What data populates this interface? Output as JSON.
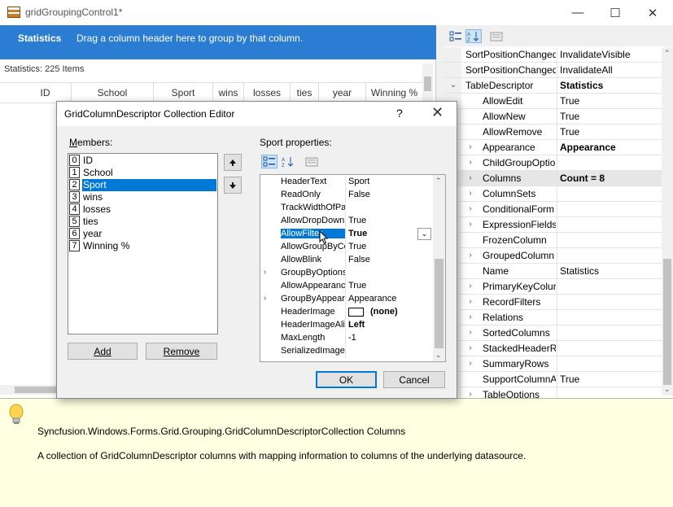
{
  "window": {
    "title": "gridGroupingControl1*",
    "minimize": "—",
    "maximize": "☐",
    "close": "✕"
  },
  "grid": {
    "table_title": "Statistics",
    "group_hint": "Drag a column header here to group by that column.",
    "stats_count": "Statistics: 225 Items",
    "columns": [
      "ID",
      "School",
      "Sport",
      "wins",
      "losses",
      "ties",
      "year",
      "Winning %"
    ]
  },
  "property_grid": {
    "rows": [
      {
        "name": "SortPositionChanged",
        "value": "InvalidateVisible",
        "indent": 1,
        "expander": "",
        "bold": false
      },
      {
        "name": "SortPositionChanged",
        "value": "InvalidateAll",
        "indent": 1,
        "expander": "",
        "bold": false
      },
      {
        "name": "TableDescriptor",
        "value": "Statistics",
        "indent": 1,
        "expander": "⌄",
        "bold": true
      },
      {
        "name": "AllowEdit",
        "value": "True",
        "indent": 2,
        "expander": "",
        "bold": false
      },
      {
        "name": "AllowNew",
        "value": "True",
        "indent": 2,
        "expander": "",
        "bold": false
      },
      {
        "name": "AllowRemove",
        "value": "True",
        "indent": 2,
        "expander": "",
        "bold": false
      },
      {
        "name": "Appearance",
        "value": "Appearance",
        "indent": 2,
        "expander": "›",
        "bold": true
      },
      {
        "name": "ChildGroupOptio",
        "value": "",
        "indent": 2,
        "expander": "›",
        "bold": false
      },
      {
        "name": "Columns",
        "value": "Count = 8",
        "indent": 2,
        "expander": "›",
        "bold": true,
        "selected": true
      },
      {
        "name": "ColumnSets",
        "value": "",
        "indent": 2,
        "expander": "›",
        "bold": false
      },
      {
        "name": "ConditionalForm",
        "value": "",
        "indent": 2,
        "expander": "›",
        "bold": false
      },
      {
        "name": "ExpressionFields",
        "value": "",
        "indent": 2,
        "expander": "›",
        "bold": false
      },
      {
        "name": "FrozenColumn",
        "value": "",
        "indent": 2,
        "expander": "",
        "bold": false
      },
      {
        "name": "GroupedColumn",
        "value": "",
        "indent": 2,
        "expander": "›",
        "bold": false
      },
      {
        "name": "Name",
        "value": "Statistics",
        "indent": 2,
        "expander": "",
        "bold": false
      },
      {
        "name": "PrimaryKeyColur",
        "value": "",
        "indent": 2,
        "expander": "›",
        "bold": false
      },
      {
        "name": "RecordFilters",
        "value": "",
        "indent": 2,
        "expander": "›",
        "bold": false
      },
      {
        "name": "Relations",
        "value": "",
        "indent": 2,
        "expander": "›",
        "bold": false
      },
      {
        "name": "SortedColumns",
        "value": "",
        "indent": 2,
        "expander": "›",
        "bold": false
      },
      {
        "name": "StackedHeaderRc",
        "value": "",
        "indent": 2,
        "expander": "›",
        "bold": false
      },
      {
        "name": "SummaryRows",
        "value": "",
        "indent": 2,
        "expander": "›",
        "bold": false
      },
      {
        "name": "SupportColumnA",
        "value": "True",
        "indent": 2,
        "expander": "",
        "bold": false
      },
      {
        "name": "TableOptions",
        "value": "",
        "indent": 2,
        "expander": "›",
        "bold": false
      }
    ]
  },
  "description": {
    "title": "Syncfusion.Windows.Forms.Grid.Grouping.GridColumnDescriptorCollection Columns",
    "text": "A collection of GridColumnDescriptor columns with mapping information to columns of the underlying datasource."
  },
  "dialog": {
    "title": "GridColumnDescriptor Collection Editor",
    "help": "?",
    "close": "✕",
    "members_label": "Members:",
    "members": [
      {
        "index": "0",
        "name": "ID"
      },
      {
        "index": "1",
        "name": "School"
      },
      {
        "index": "2",
        "name": "Sport",
        "selected": true
      },
      {
        "index": "3",
        "name": "wins"
      },
      {
        "index": "4",
        "name": "losses"
      },
      {
        "index": "5",
        "name": "ties"
      },
      {
        "index": "6",
        "name": "year"
      },
      {
        "index": "7",
        "name": "Winning %"
      }
    ],
    "add_label": "Add",
    "remove_label": "Remove",
    "properties_label": "Sport properties:",
    "properties": [
      {
        "name": "HeaderText",
        "value": "Sport",
        "expander": "",
        "bold": false
      },
      {
        "name": "ReadOnly",
        "value": "False",
        "expander": "",
        "bold": false
      },
      {
        "name": "TrackWidthOfPa",
        "value": "",
        "expander": "",
        "bold": false
      },
      {
        "name": "AllowDropDown(",
        "value": "True",
        "expander": "",
        "bold": false
      },
      {
        "name": "AllowFilter",
        "value": "True",
        "expander": "",
        "bold": true,
        "selected": true
      },
      {
        "name": "AllowGroupByCo",
        "value": "True",
        "expander": "",
        "bold": false
      },
      {
        "name": "AllowBlink",
        "value": "False",
        "expander": "",
        "bold": false
      },
      {
        "name": "GroupByOptions",
        "value": "",
        "expander": "›",
        "bold": false
      },
      {
        "name": "AllowAppearance",
        "value": "True",
        "expander": "",
        "bold": false
      },
      {
        "name": "GroupByAppeara",
        "value": "Appearance",
        "expander": "›",
        "bold": false
      },
      {
        "name": "HeaderImage",
        "value": "(none)",
        "expander": "",
        "bold": true,
        "swatch": true
      },
      {
        "name": "HeaderImageAlic",
        "value": "Left",
        "expander": "",
        "bold": true
      },
      {
        "name": "MaxLength",
        "value": "-1",
        "expander": "",
        "bold": false
      },
      {
        "name": "SerializedImageA",
        "value": "",
        "expander": "",
        "bold": false
      }
    ],
    "ok_label": "OK",
    "cancel_label": "Cancel"
  },
  "colors": {
    "header_blue": "#2b7cd3",
    "selection_blue": "#0078d7",
    "info_yellow": "#ffffe1"
  }
}
